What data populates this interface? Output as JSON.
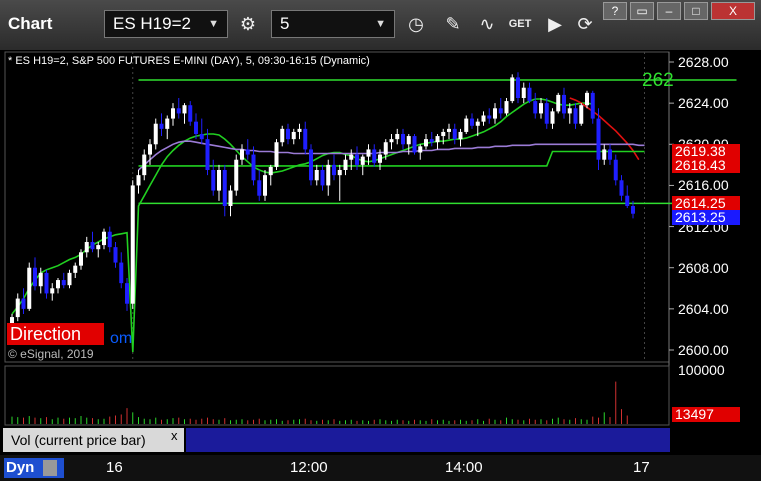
{
  "toolbar": {
    "title": "Chart",
    "symbol": "ES H19=2",
    "interval": "5",
    "win_help": "?",
    "win_close": "X"
  },
  "subtitle": "* ES H19=2, S&P 500 FUTURES E-MINI (DAY), 5, 09:30-16:15 (Dynamic)",
  "overlay": {
    "direction_label": "Direction",
    "partial_text": "om",
    "copyright": "© eSignal, 2019",
    "line_label": "262"
  },
  "volume_panel": {
    "tab_label": "Vol (current price bar)",
    "close": "x",
    "top_tick": "100000",
    "current_value": "13497"
  },
  "bottom": {
    "dyn_label": "Dyn"
  },
  "colors": {
    "up_candle": "#ffffff",
    "down_candle": "#1f1fff",
    "green_line": "#21d021",
    "red_line": "#e01010",
    "purple_line": "#9b7bd6",
    "bright_green": "#30e030"
  },
  "chart_data": {
    "type": "candlestick",
    "y_ticks": [
      "2628.00",
      "2624.00",
      "2620.00",
      "2616.00",
      "2612.00",
      "2608.00",
      "2604.00",
      "2600.00"
    ],
    "ylim": [
      2598.8,
      2629.6
    ],
    "x_ticks": [
      "16",
      "12:00",
      "14:00",
      "17"
    ],
    "price_tags": [
      {
        "label": "2619.38",
        "bg": "#e00000",
        "color": "#ffffff",
        "value": 2619.38
      },
      {
        "label": "2618.43",
        "bg": "#e00000",
        "color": "#ffffff",
        "value": 2618.43
      },
      {
        "label": "2614.25",
        "bg": "#e00000",
        "color": "#ffffff",
        "value": 2614.25
      },
      {
        "label": "2613.25",
        "bg": "#1a1aff",
        "color": "#ffffff",
        "value": 2613.25
      }
    ],
    "levels": [
      {
        "value": 2626.25,
        "from_bar": 22,
        "to_bar": 126
      },
      {
        "value": 2614.25,
        "from_bar": 22,
        "to_bar": 126
      }
    ],
    "series": [
      {
        "name": "green_avg",
        "values": [
          2603.5,
          2604.2,
          2605.0,
          2606.0,
          2606.8,
          2607.5,
          2607.8,
          2608.0,
          2608.2,
          2608.5,
          2608.8,
          2609.0,
          2609.3,
          2609.8,
          2610.2,
          2610.5,
          2610.8,
          2611.0,
          2611.2,
          2611.3,
          2611.4,
          2599.8,
          2614.0,
          2615.0,
          2616.0,
          2617.0,
          2618.0,
          2618.8,
          2619.4,
          2619.9,
          2620.3,
          2620.6,
          2620.8,
          2620.9,
          2621.0,
          2621.0,
          2620.9,
          2620.5,
          2620.0,
          2619.4,
          2618.8,
          2618.3,
          2617.8,
          2617.5,
          2617.3,
          2617.2,
          2617.3,
          2617.4,
          2617.6,
          2617.8,
          2618.0,
          2618.1,
          2618.3,
          2618.6,
          2618.9,
          2619.1,
          2619.2,
          2619.2,
          2619.0,
          2618.9,
          2618.6,
          2618.4,
          2618.3,
          2618.4,
          2618.6,
          2618.8,
          2619.0,
          2619.2,
          2619.4,
          2619.6,
          2619.8,
          2620.0,
          2620.1,
          2620.2,
          2620.3,
          2620.3,
          2620.4,
          2620.5,
          2620.5,
          2620.6,
          2620.8,
          2621.0,
          2621.2,
          2621.5,
          2621.8,
          2622.2,
          2622.7,
          2623.1,
          2623.5,
          2623.9,
          2624.2,
          2624.4,
          2624.4,
          2624.3,
          2624.1,
          2623.9,
          2623.8,
          2623.8,
          2623.9,
          2624.0,
          2624.0,
          2623.9
        ]
      },
      {
        "name": "red_avg",
        "start_bar": 97,
        "values": [
          2624.5,
          2624.3,
          2624.0,
          2623.6,
          2623.2,
          2622.8,
          2622.3,
          2621.8,
          2621.3,
          2620.7,
          2620.1,
          2619.4,
          2618.5
        ]
      },
      {
        "name": "purple_avg",
        "start_bar": 22,
        "values": [
          2617.5,
          2618.0,
          2618.5,
          2619.0,
          2619.4,
          2619.7,
          2620.0,
          2620.2,
          2620.3,
          2620.3,
          2620.2,
          2620.1,
          2620.0,
          2619.9,
          2619.8,
          2619.7,
          2619.6,
          2619.5,
          2619.5,
          2619.4,
          2619.4,
          2619.3,
          2619.3,
          2619.3,
          2619.2,
          2619.2,
          2619.2,
          2619.1,
          2619.1,
          2619.1,
          2619.1,
          2619.1,
          2619.1,
          2619.1,
          2619.1,
          2619.1,
          2619.1,
          2619.1,
          2619.1,
          2619.1,
          2619.1,
          2619.1,
          2619.2,
          2619.2,
          2619.2,
          2619.2,
          2619.3,
          2619.3,
          2619.3,
          2619.4,
          2619.4,
          2619.4,
          2619.5,
          2619.5,
          2619.5,
          2619.6,
          2619.6,
          2619.6,
          2619.6,
          2619.7,
          2619.7,
          2619.7,
          2619.8,
          2619.8,
          2619.8,
          2619.9,
          2619.9,
          2619.9,
          2619.9,
          2620.0,
          2620.0,
          2620.0,
          2620.0,
          2620.0,
          2620.0,
          2620.0,
          2620.0,
          2620.0,
          2620.0,
          2620.0,
          2620.0,
          2620.0,
          2620.0,
          2620.0,
          2620.0,
          2620.0,
          2620.0,
          2619.9,
          2619.9
        ]
      },
      {
        "name": "flat_green",
        "start_bar": 22,
        "values": [
          2617.9,
          2617.9,
          2617.9,
          2617.9,
          2617.9,
          2617.9,
          2617.9,
          2617.9,
          2617.9,
          2617.9,
          2617.9,
          2617.9,
          2617.9,
          2617.9,
          2617.9,
          2617.9,
          2617.9,
          2617.9,
          2617.9,
          2617.9,
          2617.9,
          2617.9,
          2617.9,
          2617.9,
          2617.9,
          2617.9,
          2617.9,
          2617.9,
          2617.9,
          2617.9,
          2617.9,
          2617.9,
          2617.9,
          2617.9,
          2617.9,
          2617.9,
          2617.9,
          2617.9,
          2617.9,
          2617.9,
          2617.9,
          2617.9,
          2617.9,
          2617.9,
          2617.9,
          2617.9,
          2617.9,
          2617.9,
          2617.9,
          2617.9,
          2617.9,
          2617.9,
          2617.9,
          2617.9,
          2617.9,
          2617.9,
          2617.9,
          2617.9,
          2617.9,
          2617.9,
          2617.9,
          2617.9,
          2617.9,
          2617.9,
          2617.9,
          2617.9,
          2617.9,
          2617.9,
          2617.9,
          2617.9,
          2617.9,
          2617.9,
          2619.3,
          2619.3,
          2619.3,
          2619.3,
          2619.3,
          2619.3,
          2619.3,
          2619.3,
          2619.3,
          2619.3,
          2619.3,
          2619.3,
          2619.3,
          2619.3,
          2619.3,
          2619.3,
          2619.3
        ]
      }
    ],
    "candles": [
      [
        2602.5,
        2603.5,
        2601.8,
        2603.2
      ],
      [
        2603.2,
        2605.5,
        2602.8,
        2605.0
      ],
      [
        2605.0,
        2606.0,
        2603.5,
        2604.0
      ],
      [
        2604.0,
        2608.5,
        2603.8,
        2608.0
      ],
      [
        2608.0,
        2609.0,
        2605.8,
        2606.2
      ],
      [
        2606.2,
        2608.0,
        2605.5,
        2607.5
      ],
      [
        2607.5,
        2607.8,
        2605.0,
        2605.5
      ],
      [
        2605.5,
        2606.5,
        2604.8,
        2606.0
      ],
      [
        2606.0,
        2607.0,
        2605.5,
        2606.8
      ],
      [
        2606.8,
        2607.5,
        2606.0,
        2606.3
      ],
      [
        2606.3,
        2607.8,
        2606.0,
        2607.5
      ],
      [
        2607.5,
        2608.5,
        2607.0,
        2608.2
      ],
      [
        2608.2,
        2609.8,
        2607.8,
        2609.5
      ],
      [
        2609.5,
        2611.0,
        2609.0,
        2610.5
      ],
      [
        2610.5,
        2611.5,
        2609.5,
        2609.8
      ],
      [
        2609.8,
        2610.5,
        2609.0,
        2610.2
      ],
      [
        2610.2,
        2611.8,
        2609.8,
        2611.5
      ],
      [
        2611.5,
        2612.0,
        2609.5,
        2610.0
      ],
      [
        2610.0,
        2610.5,
        2608.0,
        2608.5
      ],
      [
        2608.5,
        2609.5,
        2606.0,
        2606.5
      ],
      [
        2606.5,
        2607.0,
        2603.8,
        2604.5
      ],
      [
        2604.5,
        2616.5,
        2604.0,
        2616.0
      ],
      [
        2616.0,
        2617.5,
        2615.2,
        2617.0
      ],
      [
        2617.0,
        2619.5,
        2616.5,
        2619.0
      ],
      [
        2619.0,
        2620.5,
        2618.0,
        2620.0
      ],
      [
        2620.0,
        2622.5,
        2619.5,
        2622.0
      ],
      [
        2622.0,
        2623.0,
        2620.8,
        2621.5
      ],
      [
        2621.5,
        2622.8,
        2620.5,
        2622.5
      ],
      [
        2622.5,
        2624.0,
        2621.8,
        2623.5
      ],
      [
        2623.5,
        2624.5,
        2622.5,
        2623.0
      ],
      [
        2623.0,
        2624.0,
        2622.0,
        2623.8
      ],
      [
        2623.8,
        2624.2,
        2621.8,
        2622.2
      ],
      [
        2622.2,
        2623.0,
        2620.5,
        2621.0
      ],
      [
        2621.0,
        2622.5,
        2620.0,
        2620.5
      ],
      [
        2620.5,
        2621.5,
        2617.0,
        2617.5
      ],
      [
        2617.5,
        2618.5,
        2615.0,
        2615.5
      ],
      [
        2615.5,
        2618.0,
        2614.5,
        2617.5
      ],
      [
        2617.5,
        2618.0,
        2613.0,
        2614.0
      ],
      [
        2614.0,
        2616.0,
        2613.0,
        2615.5
      ],
      [
        2615.5,
        2619.0,
        2615.0,
        2618.5
      ],
      [
        2618.5,
        2620.0,
        2618.0,
        2619.5
      ],
      [
        2619.5,
        2620.5,
        2618.5,
        2619.0
      ],
      [
        2619.0,
        2619.8,
        2616.0,
        2616.5
      ],
      [
        2616.5,
        2617.5,
        2614.5,
        2615.0
      ],
      [
        2615.0,
        2617.5,
        2614.5,
        2617.0
      ],
      [
        2617.0,
        2618.0,
        2616.0,
        2617.8
      ],
      [
        2617.8,
        2620.5,
        2617.5,
        2620.2
      ],
      [
        2620.2,
        2621.8,
        2619.8,
        2621.5
      ],
      [
        2621.5,
        2622.0,
        2620.0,
        2620.5
      ],
      [
        2620.5,
        2621.5,
        2620.0,
        2621.2
      ],
      [
        2621.2,
        2622.0,
        2620.5,
        2621.5
      ],
      [
        2621.5,
        2622.2,
        2619.0,
        2619.5
      ],
      [
        2619.5,
        2620.0,
        2616.0,
        2616.5
      ],
      [
        2616.5,
        2618.0,
        2616.0,
        2617.5
      ],
      [
        2617.5,
        2618.0,
        2615.5,
        2616.0
      ],
      [
        2616.0,
        2618.5,
        2615.0,
        2618.0
      ],
      [
        2618.0,
        2619.0,
        2616.5,
        2617.0
      ],
      [
        2617.0,
        2618.0,
        2614.5,
        2617.5
      ],
      [
        2617.5,
        2619.0,
        2617.0,
        2618.5
      ],
      [
        2618.5,
        2619.5,
        2617.5,
        2619.0
      ],
      [
        2619.0,
        2619.8,
        2617.5,
        2618.0
      ],
      [
        2618.0,
        2619.0,
        2617.0,
        2618.8
      ],
      [
        2618.8,
        2620.0,
        2618.0,
        2619.5
      ],
      [
        2619.5,
        2620.0,
        2617.8,
        2618.2
      ],
      [
        2618.2,
        2619.5,
        2617.5,
        2619.0
      ],
      [
        2619.0,
        2620.5,
        2618.5,
        2620.2
      ],
      [
        2620.2,
        2621.0,
        2619.5,
        2620.5
      ],
      [
        2620.5,
        2621.5,
        2620.0,
        2621.0
      ],
      [
        2621.0,
        2621.5,
        2619.5,
        2620.0
      ],
      [
        2620.0,
        2621.0,
        2619.0,
        2620.8
      ],
      [
        2620.8,
        2621.0,
        2619.0,
        2619.2
      ],
      [
        2619.2,
        2620.0,
        2618.5,
        2619.8
      ],
      [
        2619.8,
        2621.0,
        2619.5,
        2620.5
      ],
      [
        2620.5,
        2621.2,
        2619.8,
        2620.2
      ],
      [
        2620.2,
        2621.0,
        2619.5,
        2620.8
      ],
      [
        2620.8,
        2621.5,
        2620.0,
        2621.2
      ],
      [
        2621.2,
        2622.0,
        2620.5,
        2621.5
      ],
      [
        2621.5,
        2622.0,
        2620.0,
        2620.5
      ],
      [
        2620.5,
        2621.5,
        2619.8,
        2621.2
      ],
      [
        2621.2,
        2622.8,
        2621.0,
        2622.5
      ],
      [
        2622.5,
        2623.0,
        2621.5,
        2621.8
      ],
      [
        2621.8,
        2622.5,
        2620.8,
        2622.2
      ],
      [
        2622.2,
        2623.2,
        2621.8,
        2622.8
      ],
      [
        2622.8,
        2623.5,
        2622.0,
        2622.5
      ],
      [
        2622.5,
        2624.0,
        2622.0,
        2623.5
      ],
      [
        2623.5,
        2624.5,
        2622.5,
        2623.0
      ],
      [
        2623.0,
        2624.5,
        2622.8,
        2624.2
      ],
      [
        2624.2,
        2626.8,
        2624.0,
        2626.5
      ],
      [
        2626.5,
        2627.0,
        2624.0,
        2624.5
      ],
      [
        2624.5,
        2626.0,
        2624.0,
        2625.5
      ],
      [
        2625.5,
        2626.0,
        2624.0,
        2624.2
      ],
      [
        2624.2,
        2625.0,
        2622.5,
        2623.0
      ],
      [
        2623.0,
        2624.5,
        2622.5,
        2624.0
      ],
      [
        2624.0,
        2624.5,
        2621.5,
        2622.0
      ],
      [
        2622.0,
        2623.5,
        2621.5,
        2623.2
      ],
      [
        2623.2,
        2625.0,
        2623.0,
        2624.8
      ],
      [
        2624.8,
        2625.5,
        2622.5,
        2623.0
      ],
      [
        2623.0,
        2624.0,
        2622.0,
        2623.5
      ],
      [
        2623.5,
        2624.0,
        2621.5,
        2622.0
      ],
      [
        2622.0,
        2624.0,
        2621.8,
        2623.8
      ],
      [
        2623.8,
        2625.2,
        2623.5,
        2625.0
      ],
      [
        2625.0,
        2625.2,
        2622.0,
        2622.5
      ],
      [
        2622.5,
        2623.5,
        2617.5,
        2618.5
      ],
      [
        2618.5,
        2620.0,
        2618.0,
        2619.5
      ],
      [
        2619.5,
        2620.0,
        2618.0,
        2618.5
      ],
      [
        2618.5,
        2619.0,
        2616.0,
        2616.5
      ],
      [
        2616.5,
        2617.0,
        2614.5,
        2615.0
      ],
      [
        2615.0,
        2616.0,
        2613.8,
        2614.0
      ],
      [
        2614.0,
        2614.5,
        2612.8,
        2613.25
      ]
    ],
    "volume_ylim": [
      0,
      100000
    ],
    "volume": [
      14000,
      13000,
      12000,
      15000,
      12000,
      11000,
      13000,
      9000,
      12000,
      10000,
      12000,
      11000,
      15000,
      12000,
      11000,
      9000,
      10000,
      14000,
      16000,
      18000,
      30000,
      22000,
      13000,
      10000,
      9000,
      12000,
      8000,
      9000,
      11000,
      12000,
      9000,
      10000,
      8000,
      10000,
      12000,
      9000,
      8000,
      11000,
      7000,
      8000,
      9000,
      7000,
      8000,
      10000,
      7000,
      8000,
      9000,
      6000,
      7000,
      8000,
      9000,
      10000,
      7000,
      6000,
      8000,
      7000,
      9000,
      6000,
      7000,
      8000,
      6000,
      7000,
      6000,
      8000,
      9000,
      7000,
      6000,
      8000,
      7000,
      6000,
      8000,
      7000,
      6000,
      9000,
      7000,
      8000,
      6000,
      7000,
      8000,
      6000,
      7000,
      9000,
      6000,
      10000,
      8000,
      7000,
      12000,
      9000,
      8000,
      7000,
      10000,
      8000,
      9000,
      7000,
      10000,
      12000,
      9000,
      8000,
      11000,
      9000,
      8000,
      14000,
      12000,
      22000,
      13000,
      80000,
      28000,
      16000
    ]
  }
}
